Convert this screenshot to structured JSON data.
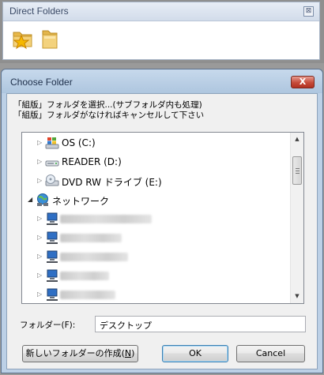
{
  "direct_folders": {
    "title": "Direct Folders",
    "close_glyph": "⊠",
    "icons": [
      "favorite-folder-icon",
      "folder-icon"
    ]
  },
  "dialog": {
    "title": "Choose Folder",
    "close_glyph": "X",
    "instruction_line1": "「組版」フォルダを選択...(サブフォルダ内も処理)",
    "instruction_line2": "「組版」フォルダがなければキャンセルして下さい",
    "tree": {
      "items": [
        {
          "label": "OS (C:)",
          "icon": "windows-drive-icon"
        },
        {
          "label": "READER (D:)",
          "icon": "drive-icon"
        },
        {
          "label": "DVD RW ドライブ (E:)",
          "icon": "dvd-drive-icon"
        },
        {
          "label": "ネットワーク",
          "icon": "network-icon",
          "expanded": true
        },
        {
          "label": "",
          "icon": "network-computer-icon",
          "obscured": true
        },
        {
          "label": "",
          "icon": "network-computer-icon",
          "obscured": true
        },
        {
          "label": "",
          "icon": "network-computer-icon",
          "obscured": true
        },
        {
          "label": "",
          "icon": "network-computer-icon",
          "obscured": true
        },
        {
          "label": "",
          "icon": "network-computer-icon",
          "obscured": true
        }
      ],
      "scroll_up_glyph": "▲",
      "scroll_down_glyph": "▼"
    },
    "folder_label": "フォルダー(F):",
    "folder_value": "デスクトップ",
    "buttons": {
      "new_folder_prefix": "新しいフォルダーの作成(",
      "new_folder_key": "N",
      "new_folder_suffix": ")",
      "ok": "OK",
      "cancel": "Cancel"
    }
  }
}
